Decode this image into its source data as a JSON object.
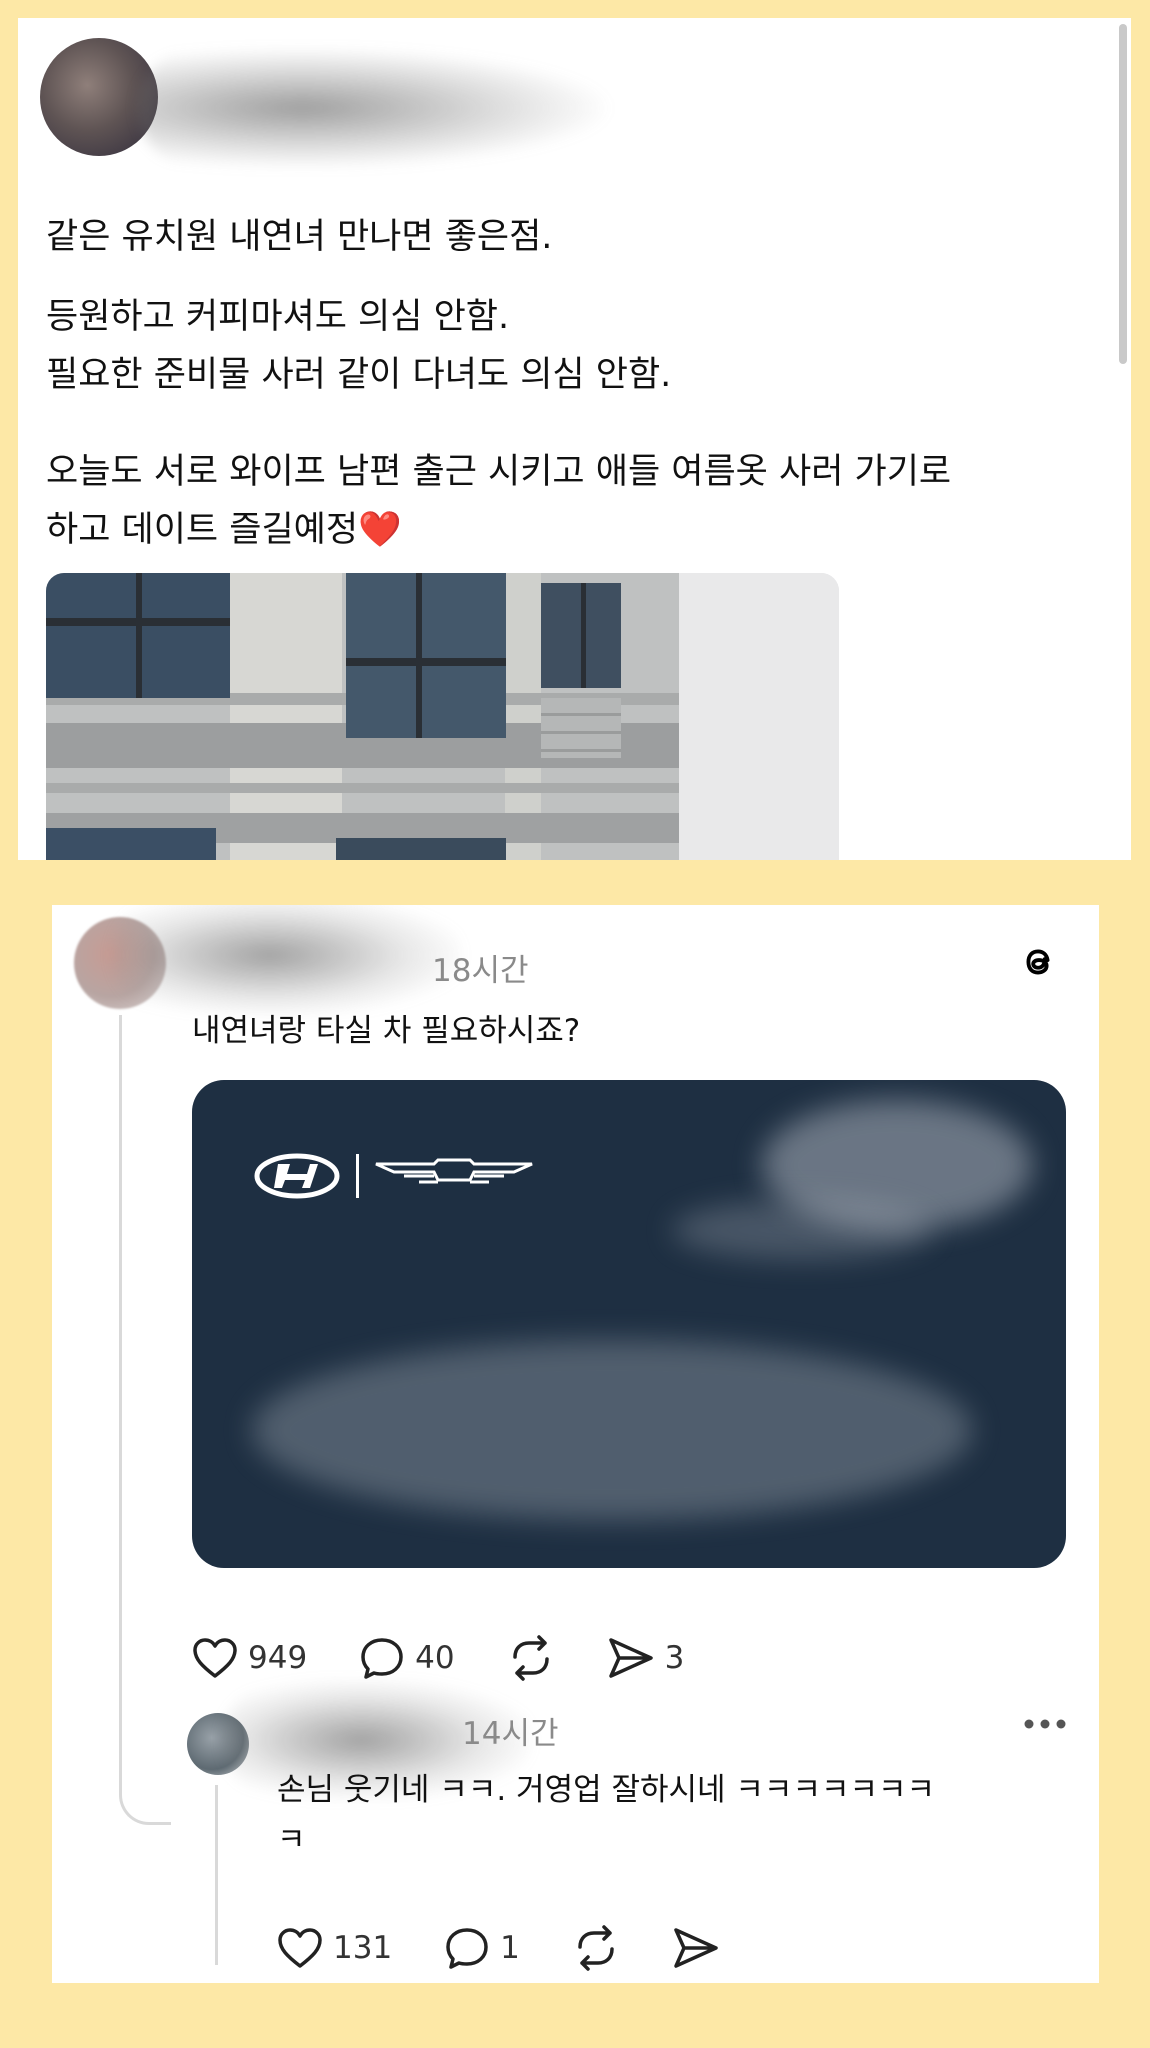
{
  "tweet": {
    "lines": [
      "같은 유치원 내연녀 만나면 좋은점.",
      "등원하고 커피마셔도 의심 안함.\n필요한 준비물 사러 같이 다녀도 의심 안함.",
      "오늘도 서로 와이프 남편 출근 시키고 애들 여름옷 사러 가기로\n하고 데이트 즐길예정❤️"
    ]
  },
  "threads": {
    "post": {
      "time": "18시간",
      "text": "내연녀랑 타실 차 필요하시죠?",
      "likes": "949",
      "comments": "40",
      "shares": "3"
    },
    "reply": {
      "time": "14시간",
      "text": "손님 웃기네  ㅋㅋ. 거영업 잘하시네 ㅋㅋㅋㅋㅋㅋㅋ\nㅋ",
      "likes": "131",
      "comments": "1"
    }
  },
  "colors": {
    "background": "#fde8a6",
    "card": "#1e2f42",
    "timestamp": "#8a8a8a"
  }
}
